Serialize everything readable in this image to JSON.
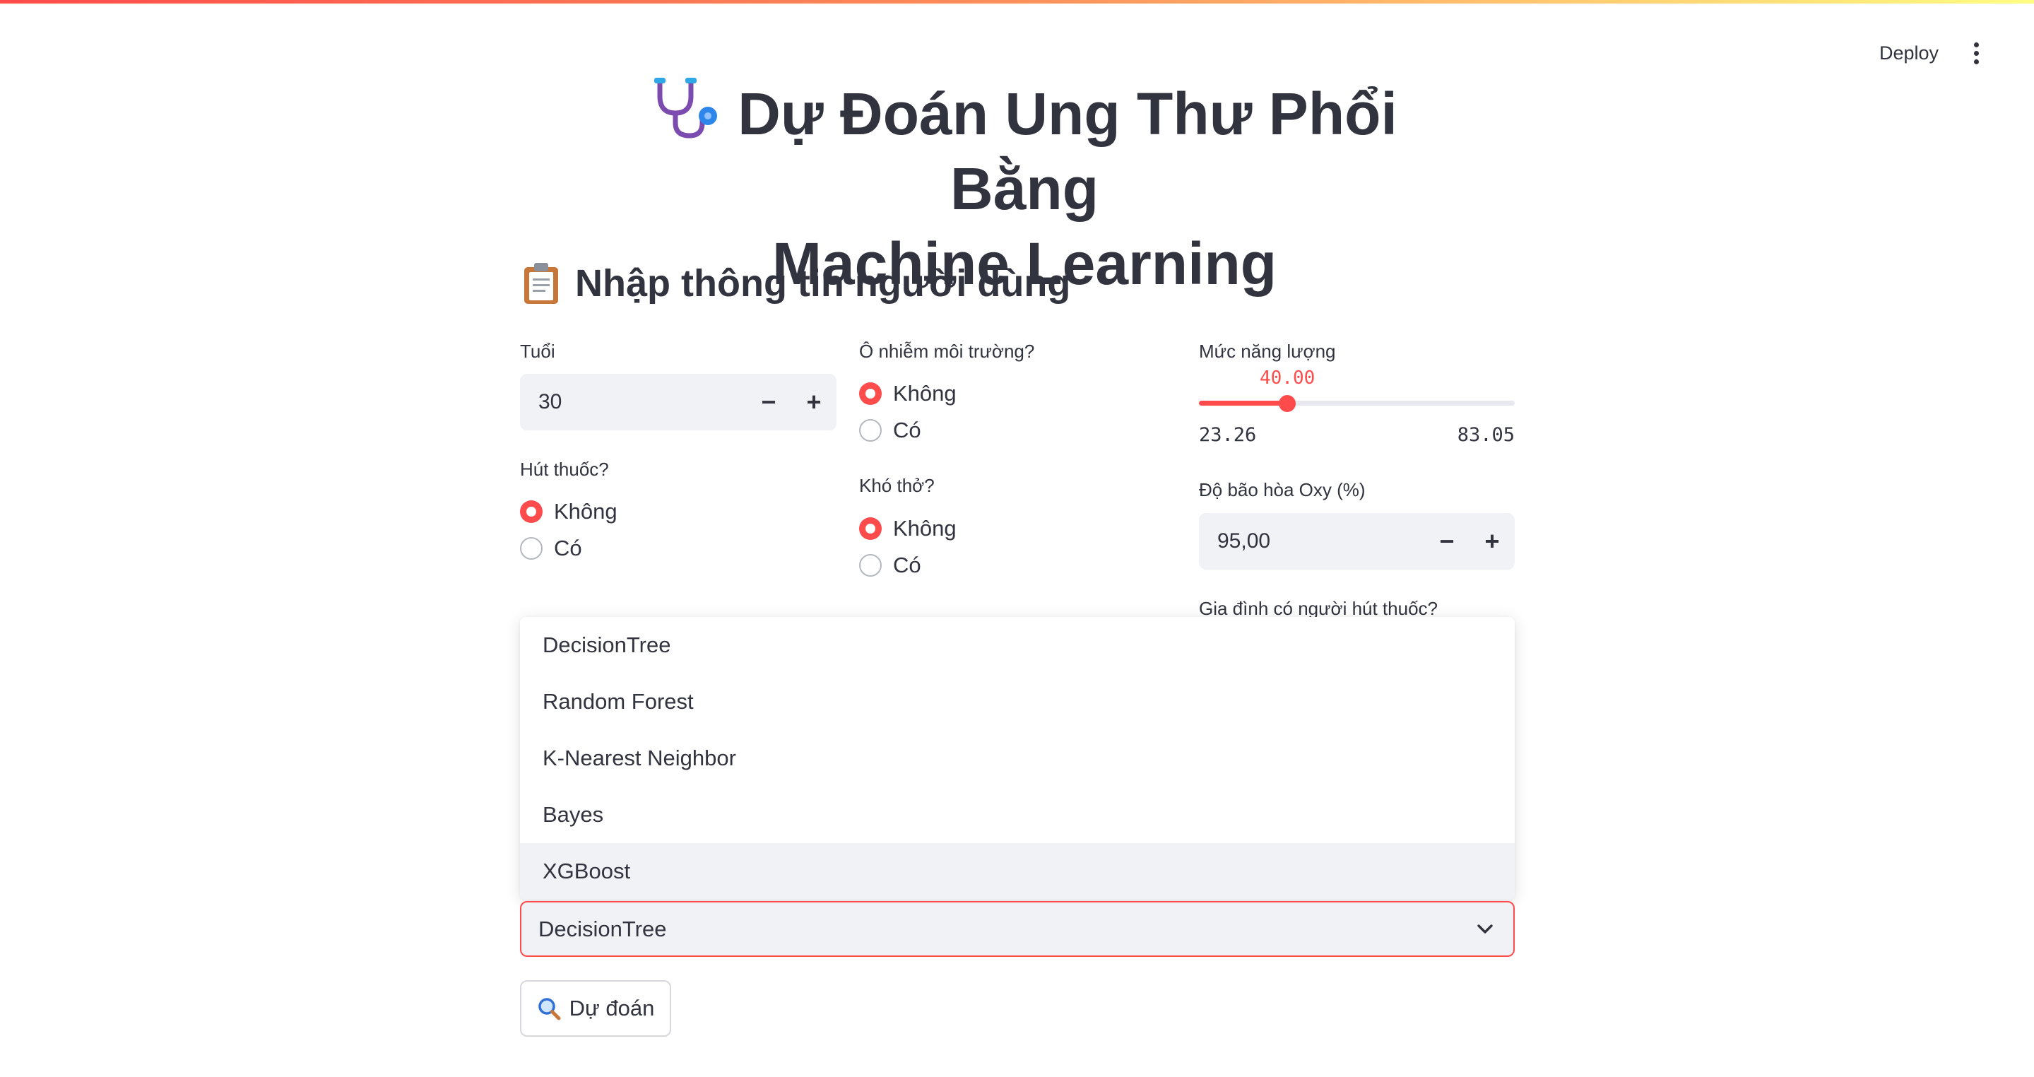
{
  "header": {
    "deploy_label": "Deploy",
    "menu_icon": "kebab-menu-icon"
  },
  "page": {
    "title_icon": "stethoscope-icon",
    "title_line1": "Dự Đoán Ung Thư Phổi Bằng",
    "title_line2": "Machine Learning",
    "subheader_icon": "clipboard-icon",
    "subheader": "Nhập thông tin người dùng"
  },
  "form": {
    "age": {
      "label": "Tuổi",
      "value": "30",
      "minus": "−",
      "plus": "+"
    },
    "smoking": {
      "label": "Hút thuốc?",
      "options": [
        "Không",
        "Có"
      ],
      "selected": "Không"
    },
    "pollution": {
      "label": "Ô nhiễm môi trường?",
      "options": [
        "Không",
        "Có"
      ],
      "selected": "Không"
    },
    "breathing": {
      "label": "Khó thở?",
      "options": [
        "Không",
        "Có"
      ],
      "selected": "Không"
    },
    "energy": {
      "label": "Mức năng lượng",
      "value": "40.00",
      "min": "23.26",
      "max": "83.05",
      "value_num": 40.0,
      "min_num": 23.26,
      "max_num": 83.05
    },
    "oxygen": {
      "label": "Độ bão hòa Oxy (%)",
      "value": "95,00",
      "minus": "−",
      "plus": "+"
    },
    "hidden_label": "Gia đình có người hút thuốc?"
  },
  "model_select": {
    "options": [
      "DecisionTree",
      "Random Forest",
      "K-Nearest Neighbor",
      "Bayes",
      "XGBoost"
    ],
    "hovered": "XGBoost",
    "selected": "DecisionTree"
  },
  "predict_button": {
    "icon": "magnifier-icon",
    "label": "Dự đoán"
  },
  "colors": {
    "accent": "#ff4b4b",
    "input_bg": "#f0f2f6",
    "text": "#31333f"
  }
}
